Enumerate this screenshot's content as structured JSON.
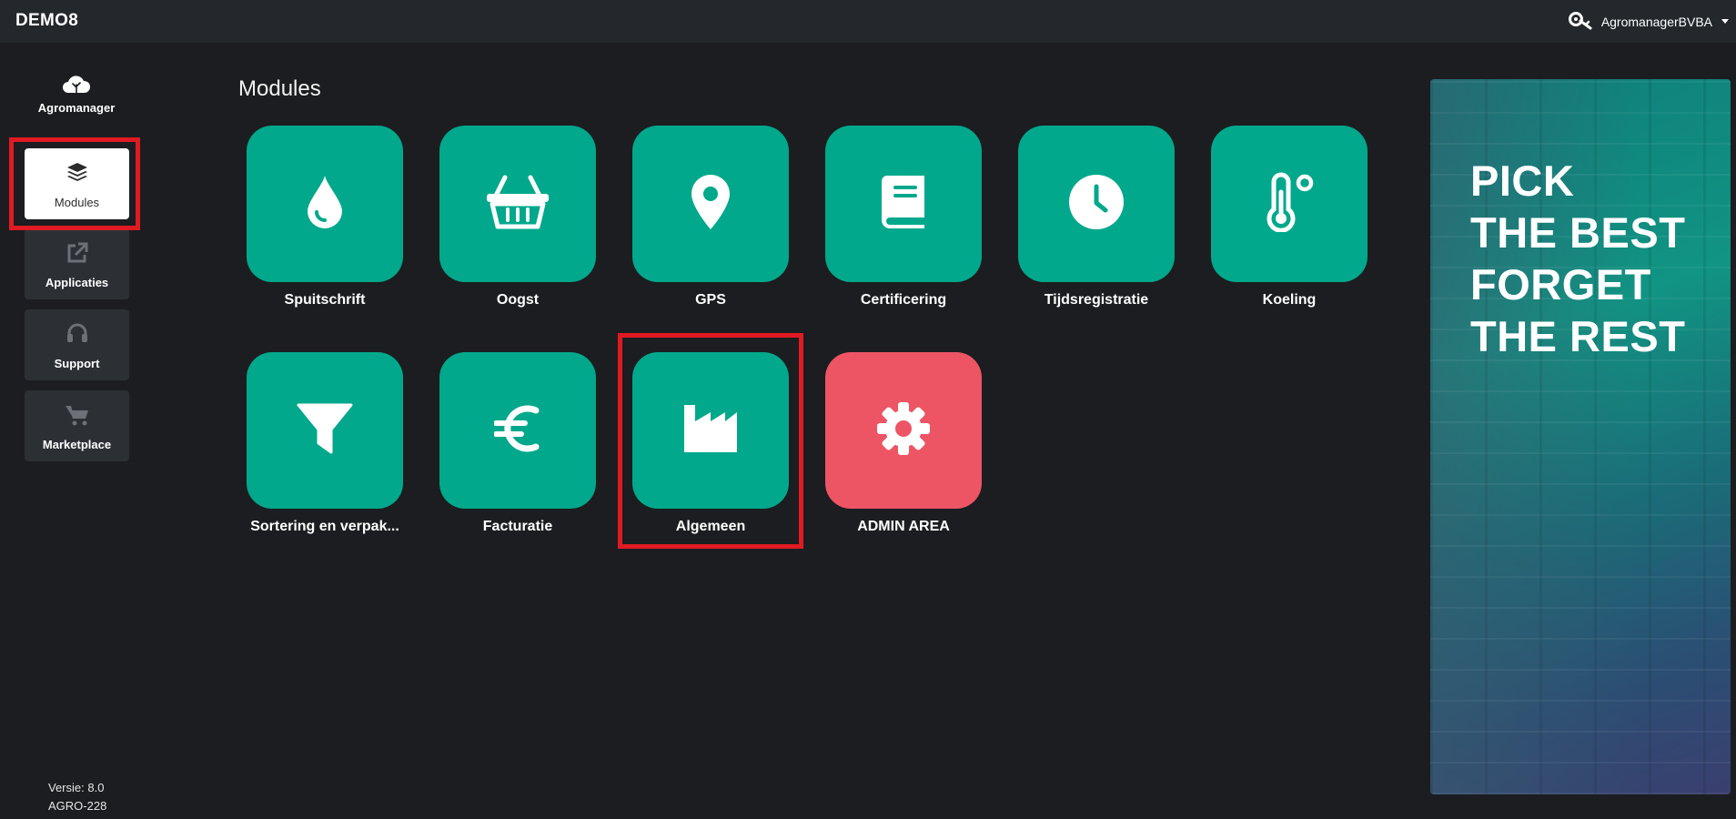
{
  "app": {
    "title": "DEMO8"
  },
  "user": {
    "name": "AgromanagerBVBA"
  },
  "sidebar": {
    "logo_text": "Agromanager",
    "items": [
      {
        "label": "Modules",
        "icon": "layers-icon"
      },
      {
        "label": "Applicaties",
        "icon": "external-link-icon"
      },
      {
        "label": "Support",
        "icon": "headset-icon"
      },
      {
        "label": "Marketplace",
        "icon": "cart-icon"
      }
    ],
    "version": "Versie: 8.0",
    "build": "AGRO-228"
  },
  "main": {
    "title": "Modules",
    "modules": [
      {
        "label": "Spuitschrift",
        "icon": "droplet-icon",
        "color": "#01a88b"
      },
      {
        "label": "Oogst",
        "icon": "basket-icon",
        "color": "#01a88b"
      },
      {
        "label": "GPS",
        "icon": "map-pin-icon",
        "color": "#01a88b"
      },
      {
        "label": "Certificering",
        "icon": "book-icon",
        "color": "#01a88b"
      },
      {
        "label": "Tijdsregistratie",
        "icon": "clock-icon",
        "color": "#01a88b"
      },
      {
        "label": "Koeling",
        "icon": "thermometer-icon",
        "color": "#01a88b"
      },
      {
        "label": "Sortering en verpak...",
        "icon": "filter-icon",
        "color": "#01a88b"
      },
      {
        "label": "Facturatie",
        "icon": "euro-icon",
        "color": "#01a88b"
      },
      {
        "label": "Algemeen",
        "icon": "factory-icon",
        "color": "#01a88b"
      },
      {
        "label": "ADMIN AREA",
        "icon": "gear-icon",
        "color": "#ed5565"
      }
    ]
  },
  "promo": {
    "lines": [
      "PICK",
      "THE BEST",
      "FORGET",
      "THE REST"
    ]
  },
  "colors": {
    "accent": "#01a88b",
    "admin": "#ed5565",
    "highlight": "#e01a22",
    "topbar": "#24282d",
    "background": "#1b1d20"
  }
}
